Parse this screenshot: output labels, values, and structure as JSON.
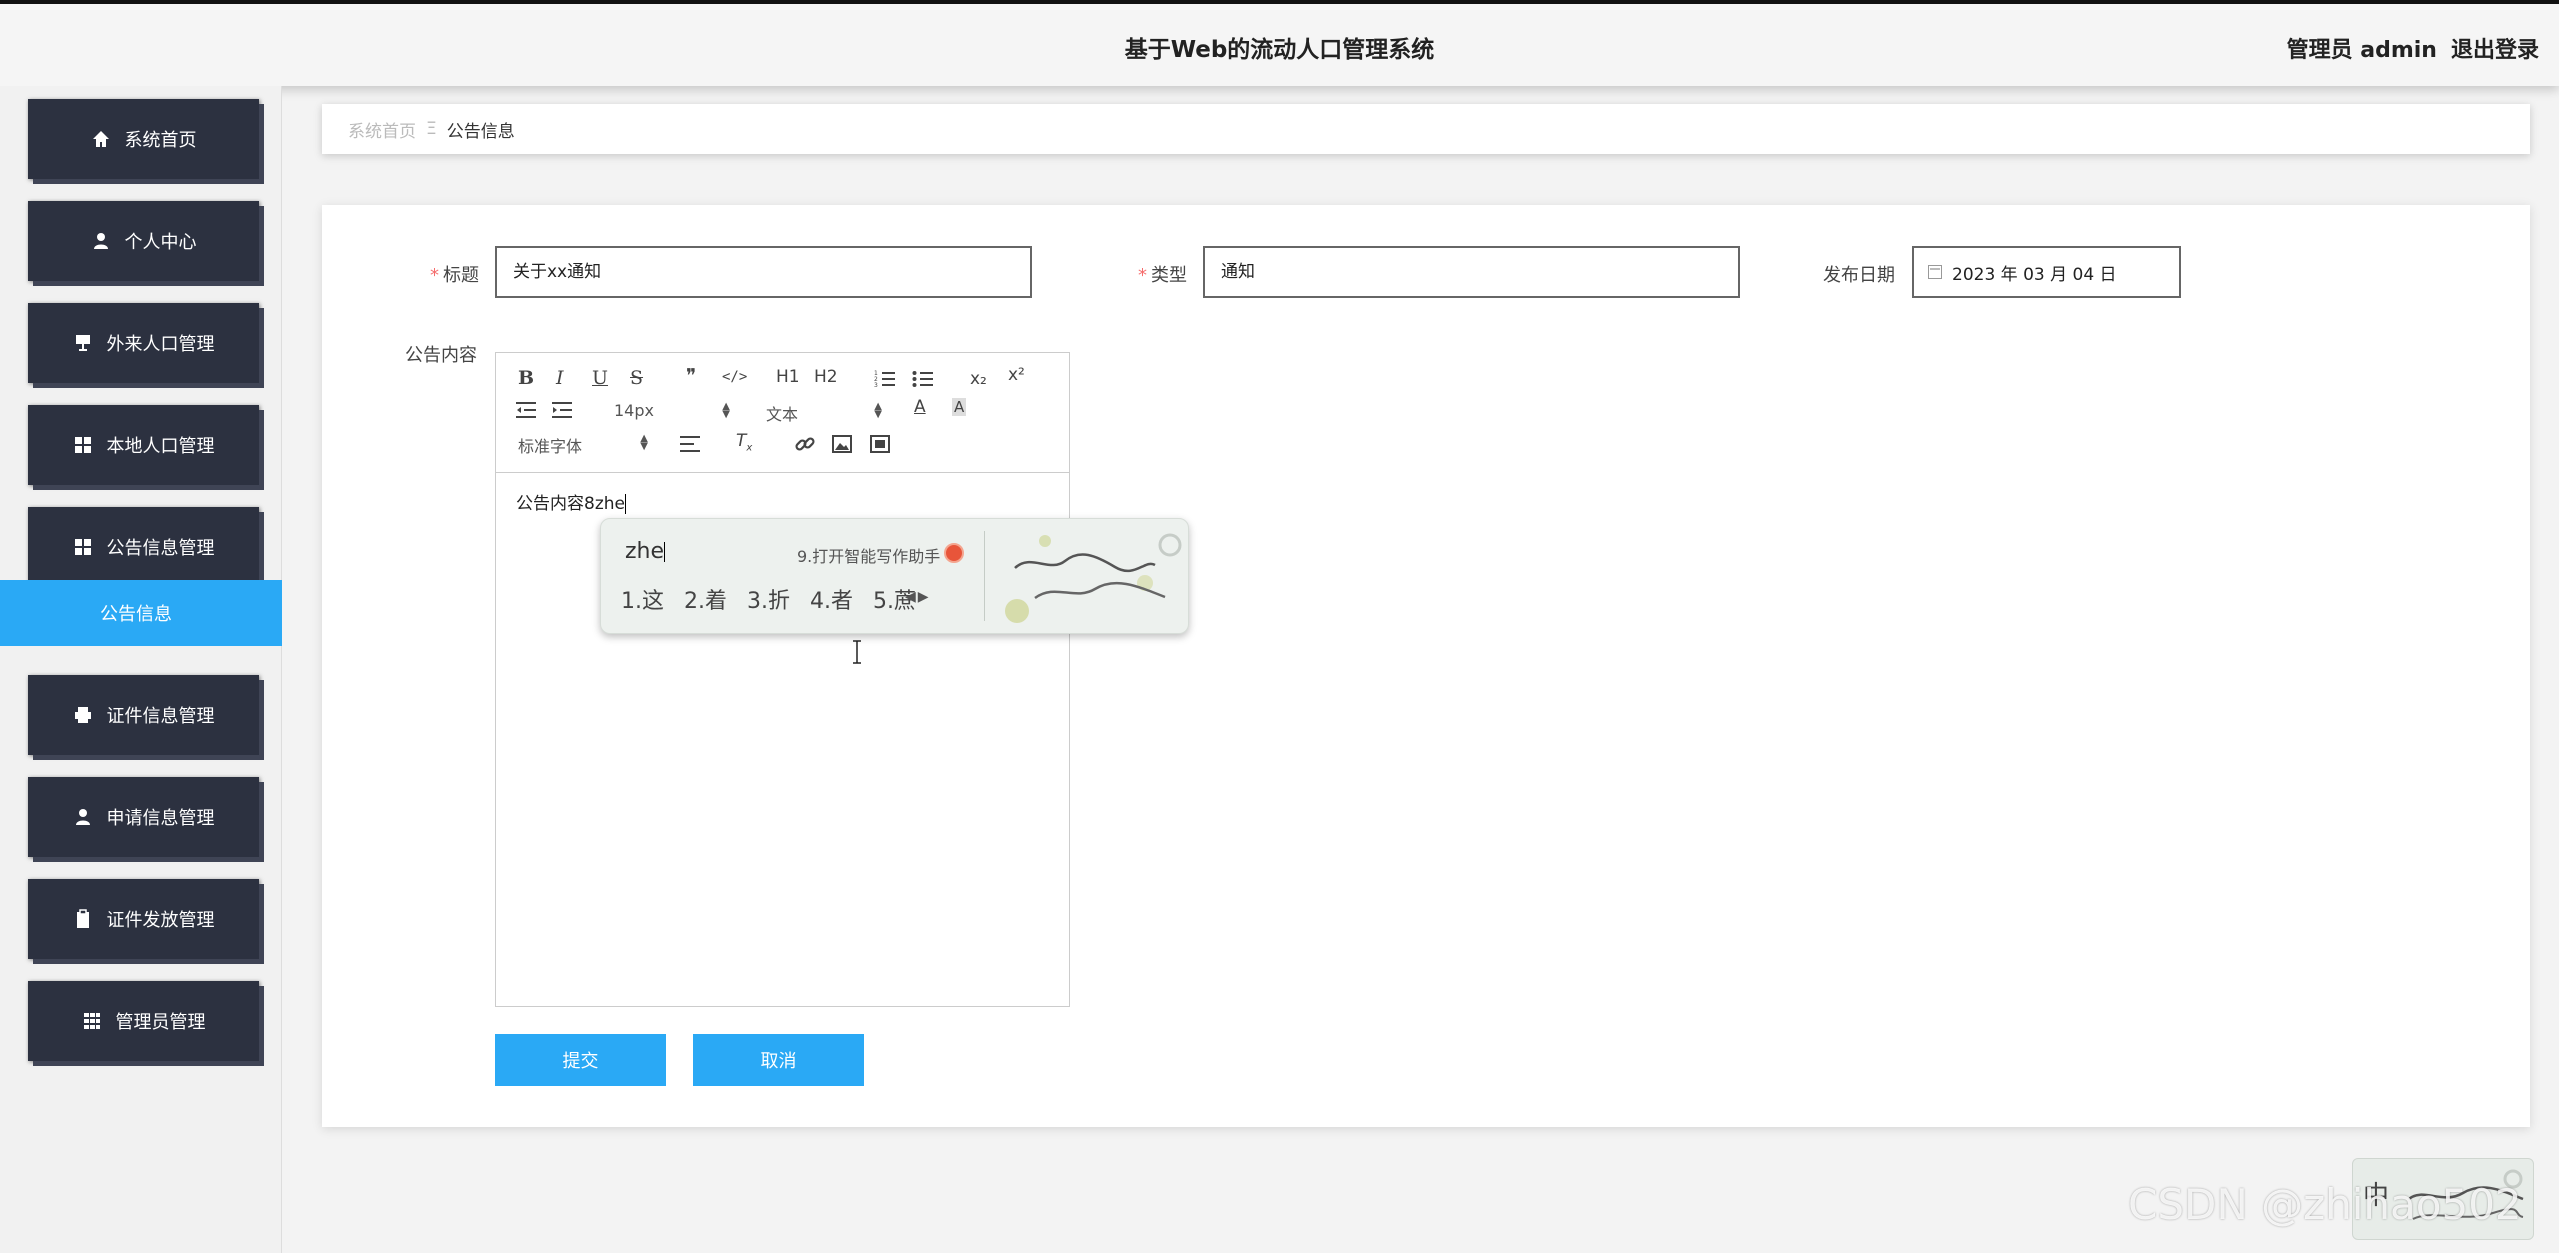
{
  "header": {
    "title": "基于Web的流动人口管理系统",
    "user_label": "管理员 admin",
    "logout": "退出登录"
  },
  "sidebar": {
    "items": [
      {
        "label": "系统首页",
        "icon": "home-icon"
      },
      {
        "label": "个人中心",
        "icon": "person-icon"
      },
      {
        "label": "外来人口管理",
        "icon": "sign-icon"
      },
      {
        "label": "本地人口管理",
        "icon": "grid-icon"
      },
      {
        "label": "公告信息管理",
        "icon": "grid-icon"
      },
      {
        "label": "证件信息管理",
        "icon": "printer-icon"
      },
      {
        "label": "申请信息管理",
        "icon": "user-icon"
      },
      {
        "label": "证件发放管理",
        "icon": "clipboard-icon"
      },
      {
        "label": "管理员管理",
        "icon": "table-icon"
      }
    ],
    "active_subitem": "公告信息"
  },
  "breadcrumb": {
    "home": "系统首页",
    "separator": "Ξ",
    "current": "公告信息"
  },
  "form": {
    "title_label": "标题",
    "title_value": "关于xx通知",
    "type_label": "类型",
    "type_value": "通知",
    "date_label": "发布日期",
    "date_value": "2023 年 03 月 04 日",
    "content_label": "公告内容",
    "content_value": "公告内容8zhe",
    "submit": "提交",
    "cancel": "取消"
  },
  "editor_toolbar": {
    "font_size": "14px",
    "text_style": "文本",
    "font_family": "标准字体",
    "bold": "B",
    "italic": "I",
    "underline": "U",
    "strike": "S",
    "quote": "❞",
    "code": "</>",
    "h1": "H1",
    "h2": "H2",
    "subscript": "x₂",
    "superscript": "x²"
  },
  "ime": {
    "pinyin": "zhe",
    "assist": "9.打开智能写作助手",
    "candidates": [
      "1.这",
      "2.着",
      "3.折",
      "4.者",
      "5.蔗"
    ],
    "mini_label": "中"
  },
  "watermark": "CSDN @zhihao502",
  "colors": {
    "accent": "#2aa9f5",
    "sidebar_bg": "#2c3140",
    "required": "#f56c6c"
  }
}
